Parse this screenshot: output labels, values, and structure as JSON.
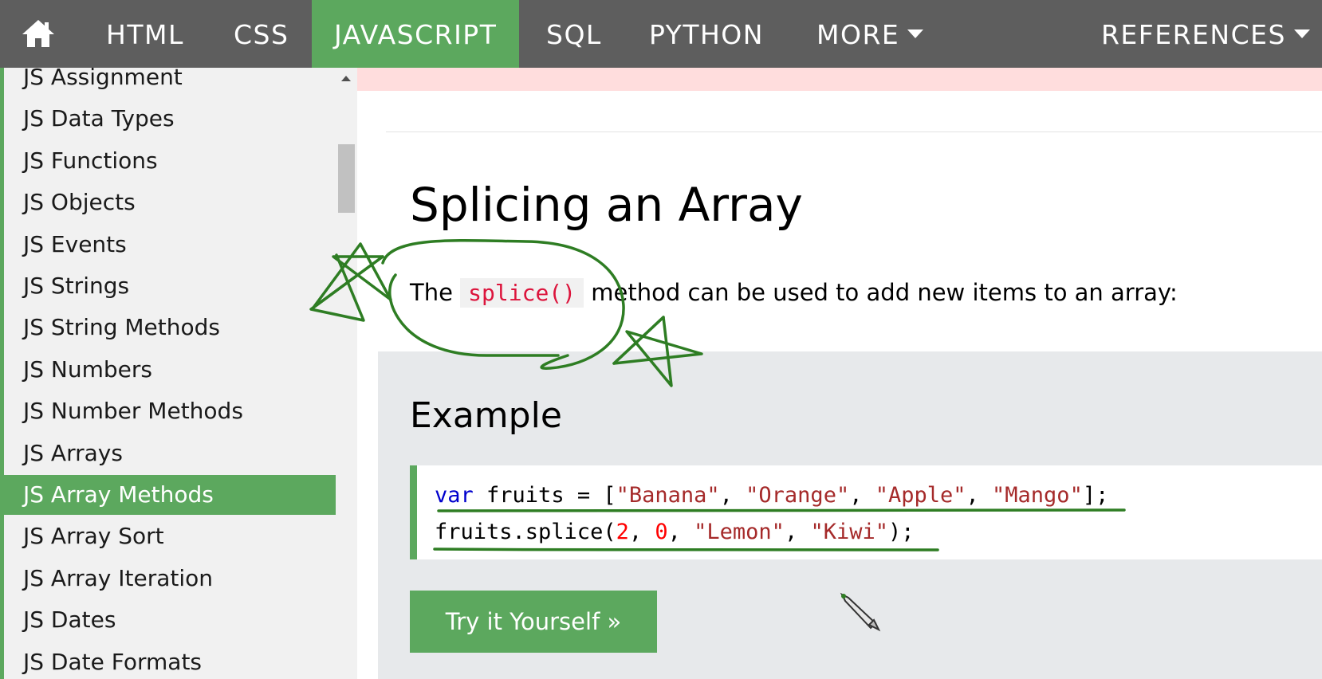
{
  "topnav": {
    "home_icon": "home-icon",
    "items": [
      {
        "label": "HTML",
        "active": false
      },
      {
        "label": "CSS",
        "active": false
      },
      {
        "label": "JAVASCRIPT",
        "active": true
      },
      {
        "label": "SQL",
        "active": false
      },
      {
        "label": "PYTHON",
        "active": false
      },
      {
        "label": "MORE",
        "active": false,
        "dropdown": true
      },
      {
        "label": "REFERENCES",
        "active": false,
        "dropdown": true
      }
    ]
  },
  "sidebar": {
    "active_index": 10,
    "items": [
      {
        "label": "JS Assignment"
      },
      {
        "label": "JS Data Types"
      },
      {
        "label": "JS Functions"
      },
      {
        "label": "JS Objects"
      },
      {
        "label": "JS Events"
      },
      {
        "label": "JS Strings"
      },
      {
        "label": "JS String Methods"
      },
      {
        "label": "JS Numbers"
      },
      {
        "label": "JS Number Methods"
      },
      {
        "label": "JS Arrays"
      },
      {
        "label": "JS Array Methods"
      },
      {
        "label": "JS Array Sort"
      },
      {
        "label": "JS Array Iteration"
      },
      {
        "label": "JS Dates"
      },
      {
        "label": "JS Date Formats"
      }
    ]
  },
  "main": {
    "heading": "Splicing an Array",
    "paragraph": {
      "prefix": "The ",
      "code": "splice()",
      "suffix": " method can be used to add new items to an array:"
    },
    "example": {
      "title": "Example",
      "code_lines": [
        [
          {
            "text": "var",
            "cls": "kw"
          },
          {
            "text": " fruits = [",
            "cls": ""
          },
          {
            "text": "\"Banana\"",
            "cls": "str"
          },
          {
            "text": ", ",
            "cls": ""
          },
          {
            "text": "\"Orange\"",
            "cls": "str"
          },
          {
            "text": ", ",
            "cls": ""
          },
          {
            "text": "\"Apple\"",
            "cls": "str"
          },
          {
            "text": ", ",
            "cls": ""
          },
          {
            "text": "\"Mango\"",
            "cls": "str"
          },
          {
            "text": "];",
            "cls": ""
          }
        ],
        [
          {
            "text": "fruits.splice(",
            "cls": ""
          },
          {
            "text": "2",
            "cls": "num"
          },
          {
            "text": ", ",
            "cls": ""
          },
          {
            "text": "0",
            "cls": "num"
          },
          {
            "text": ", ",
            "cls": ""
          },
          {
            "text": "\"Lemon\"",
            "cls": "str"
          },
          {
            "text": ", ",
            "cls": ""
          },
          {
            "text": "\"Kiwi\"",
            "cls": "str"
          },
          {
            "text": ");",
            "cls": ""
          }
        ]
      ],
      "try_button_label": "Try it Yourself »"
    }
  },
  "colors": {
    "nav_bg": "#5e5e5e",
    "accent_green": "#5ca85e",
    "sidebar_bg": "#f1f1f1",
    "example_bg": "#e7e9eb",
    "annotation_ink": "#2e7d23",
    "inline_code_red": "#dc143c"
  },
  "annotations": {
    "ink": "green hand-drawn pen",
    "marks": [
      "star-left",
      "circle-around-splice",
      "star-right",
      "underline-code-line-1",
      "underline-code-line-2"
    ],
    "cursor": "pen-cursor-icon"
  }
}
